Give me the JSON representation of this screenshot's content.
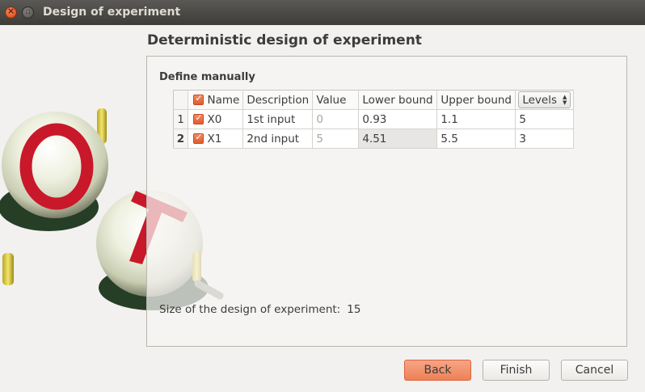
{
  "window": {
    "title": "Design of experiment",
    "close_icon_glyph": "×",
    "minimize_icon_glyph": "▫"
  },
  "page": {
    "heading": "Deterministic design of experiment",
    "section_label": "Define manually"
  },
  "logo": {
    "lettering": "OT",
    "colors": {
      "sphere": "#eef0df",
      "letter": "#c8182a",
      "pin": "#d9c93a",
      "shadow": "#0f2a0f"
    }
  },
  "table": {
    "header_checkbox_checked": true,
    "columns": {
      "name": "Name",
      "description": "Description",
      "value": "Value",
      "lower": "Lower bound",
      "upper": "Upper bound",
      "levels": "Levels"
    },
    "levels_arrows": {
      "up": "▲",
      "down": "▼"
    },
    "rows": [
      {
        "index": "1",
        "checked": true,
        "name": "X0",
        "description": "1st input",
        "value": "0",
        "lower": "0.93",
        "upper": "1.1",
        "levels": "5"
      },
      {
        "index": "2",
        "checked": true,
        "name": "X1",
        "description": "2nd input",
        "value": "5",
        "lower": "4.51",
        "upper": "5.5",
        "levels": "3"
      }
    ],
    "checkmark_glyph": "✓"
  },
  "summary": {
    "label": "Size of the design of experiment:",
    "value": "15"
  },
  "buttons": {
    "back": "Back",
    "finish": "Finish",
    "cancel": "Cancel"
  },
  "colors": {
    "accent": "#ef8358",
    "titlebar": "#4a4945",
    "background": "#f2f1f0"
  }
}
